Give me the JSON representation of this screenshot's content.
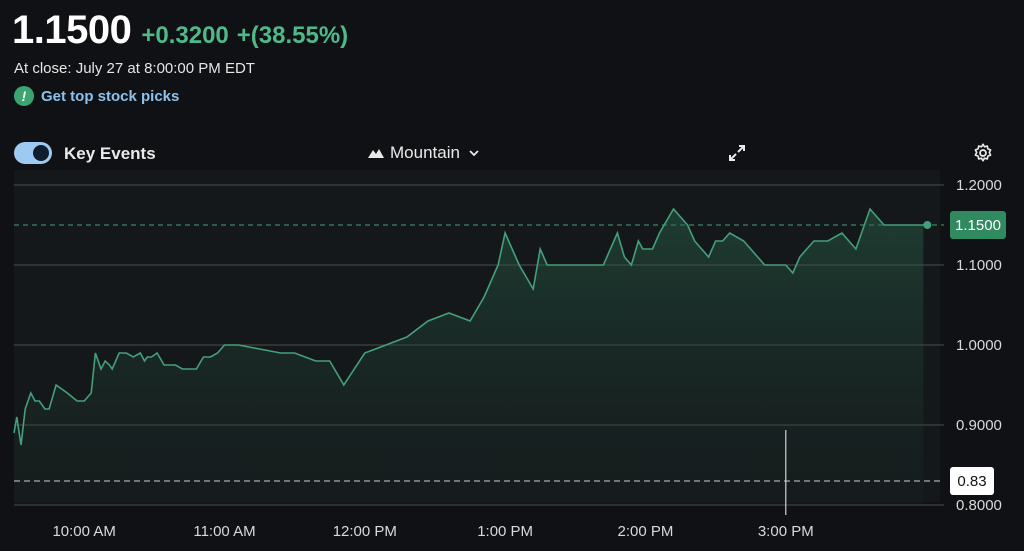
{
  "quote": {
    "price": "1.1500",
    "change": "+0.3200",
    "change_percent": "+(38.55%)",
    "close_text": "At close: July 27 at 8:00:00 PM EDT"
  },
  "promo": {
    "icon_glyph": "!",
    "label": "Get top stock picks"
  },
  "toolbar": {
    "key_events_label": "Key Events",
    "key_events_on": true,
    "chart_type_label": "Mountain"
  },
  "colors": {
    "positive": "#4fb98a",
    "line": "#43a07a",
    "link": "#8cc1ee",
    "toggle": "#9ccaf2",
    "background": "#101114"
  },
  "chart_data": {
    "type": "area",
    "title": "",
    "xlabel": "",
    "ylabel": "",
    "ylim": [
      0.8,
      1.2
    ],
    "xlim": [
      9.5,
      16.0
    ],
    "x_tick_values": [
      10,
      11,
      12,
      13,
      14,
      15
    ],
    "x_tick_labels": [
      "10:00 AM",
      "11:00 AM",
      "12:00 PM",
      "1:00 PM",
      "2:00 PM",
      "3:00 PM"
    ],
    "y_tick_values": [
      1.2,
      1.1,
      1.0,
      0.9,
      0.8
    ],
    "y_tick_labels": [
      "1.2000",
      "1.1000",
      "1.0000",
      "0.9000",
      "0.8000"
    ],
    "previous_close": 1.15,
    "previous_close_label": "1.1500",
    "crosshair_value": 0.83,
    "crosshair_label": "0.83",
    "crosshair_x": 15.0,
    "grid": true,
    "series": [
      {
        "x": [
          9.5,
          9.52,
          9.55,
          9.58,
          9.62,
          9.65,
          9.68,
          9.72,
          9.75,
          9.8,
          9.88,
          9.95,
          10.0,
          10.05,
          10.08,
          10.12,
          10.15,
          10.18,
          10.2,
          10.25,
          10.3,
          10.35,
          10.4,
          10.43,
          10.45,
          10.48,
          10.52,
          10.57,
          10.6,
          10.65,
          10.7,
          10.75,
          10.8,
          10.85,
          10.9,
          10.95,
          11.0,
          11.1,
          11.25,
          11.4,
          11.5,
          11.65,
          11.7,
          11.75,
          11.85,
          12.0,
          12.15,
          12.3,
          12.45,
          12.6,
          12.75,
          12.85,
          12.9,
          12.95,
          13.0,
          13.1,
          13.2,
          13.25,
          13.3,
          13.35,
          13.38,
          13.42,
          13.45,
          13.5,
          13.6,
          13.7,
          13.8,
          13.85,
          13.9,
          13.95,
          13.98,
          14.0,
          14.05,
          14.1,
          14.2,
          14.25,
          14.3,
          14.35,
          14.4,
          14.45,
          14.5,
          14.55,
          14.6,
          14.7,
          14.75,
          14.8,
          14.85,
          14.9,
          14.95,
          15.0,
          15.05,
          15.1,
          15.15,
          15.2,
          15.3,
          15.4,
          15.5,
          15.6,
          15.65,
          15.7,
          15.75,
          15.8,
          15.85,
          15.9,
          15.95,
          15.98
        ],
        "y": [
          0.89,
          0.91,
          0.875,
          0.92,
          0.94,
          0.93,
          0.93,
          0.92,
          0.92,
          0.95,
          0.94,
          0.93,
          0.93,
          0.94,
          0.99,
          0.97,
          0.98,
          0.975,
          0.97,
          0.99,
          0.99,
          0.985,
          0.99,
          0.98,
          0.985,
          0.985,
          0.99,
          0.975,
          0.975,
          0.975,
          0.97,
          0.97,
          0.97,
          0.985,
          0.985,
          0.99,
          1.0,
          1.0,
          0.995,
          0.99,
          0.99,
          0.98,
          0.98,
          0.98,
          0.95,
          0.99,
          1.0,
          1.01,
          1.03,
          1.04,
          1.03,
          1.06,
          1.08,
          1.1,
          1.14,
          1.1,
          1.07,
          1.12,
          1.1,
          1.1,
          1.1,
          1.1,
          1.1,
          1.1,
          1.1,
          1.1,
          1.14,
          1.11,
          1.1,
          1.13,
          1.12,
          1.12,
          1.12,
          1.14,
          1.17,
          1.16,
          1.15,
          1.13,
          1.12,
          1.11,
          1.13,
          1.13,
          1.14,
          1.13,
          1.12,
          1.11,
          1.1,
          1.1,
          1.1,
          1.1,
          1.09,
          1.11,
          1.12,
          1.13,
          1.13,
          1.14,
          1.12,
          1.17,
          1.16,
          1.15,
          1.15,
          1.15,
          1.15,
          1.15,
          1.15,
          1.15
        ]
      }
    ]
  }
}
